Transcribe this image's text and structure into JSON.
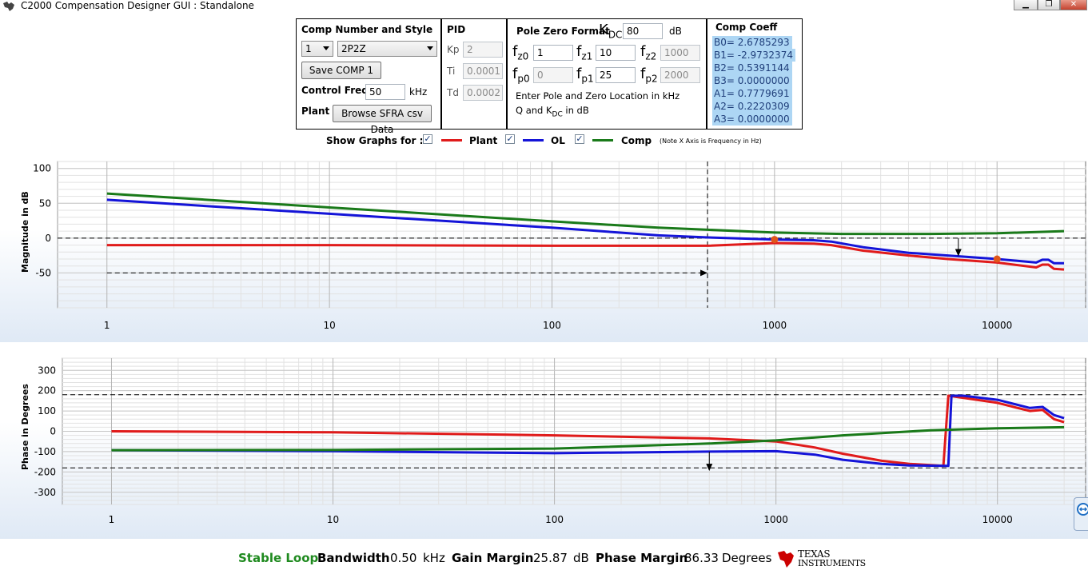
{
  "window": {
    "title": "C2000 Compensation Designer GUI : Standalone",
    "min_glyph": "▁",
    "max_glyph": "❐",
    "close_glyph": "✕"
  },
  "comp_panel": {
    "title": "Comp Number and Style",
    "comp_number": "1",
    "comp_style": "2P2Z",
    "save_label": "Save COMP 1",
    "control_freq_label": "Control Freq",
    "control_freq_value": "50",
    "control_freq_unit": "kHz",
    "plant_label": "Plant",
    "browse_label": "Browse SFRA csv Data"
  },
  "pid_panel": {
    "title": "PID",
    "kp_label": "Kp",
    "kp_value": "2",
    "ti_label": "Ti",
    "ti_value": "0.0001",
    "td_label": "Td",
    "td_value": "0.0002"
  },
  "pz_panel": {
    "title": "Pole Zero Format",
    "kdc_main": "K",
    "kdc_sub": "DC",
    "kdc_value": "80",
    "kdc_unit": "dB",
    "fz0_value": "1",
    "fz1_value": "10",
    "fz2_value": "1000",
    "fp0_value": "0",
    "fp1_value": "25",
    "fp2_value": "2000",
    "hint_line1": "Enter Pole and Zero Location in kHz",
    "hint_line2_a": "Q and K",
    "hint_line2_sub": "DC",
    "hint_line2_b": " in dB"
  },
  "coeff_panel": {
    "title": "Comp Coeff",
    "lines": [
      "B0= 2.6785293",
      "B1= -2.9732374",
      "B2= 0.5391144",
      "B3= 0.0000000",
      "A1= 0.7779691",
      "A2= 0.2220309",
      "A3= 0.0000000"
    ]
  },
  "show_graphs": {
    "label": "Show Graphs for :",
    "plant": "Plant",
    "ol": "OL",
    "comp": "Comp",
    "note": "(Note X Axis is Frequency in Hz)",
    "check_glyph": "✓"
  },
  "colors": {
    "plant": "#e01b1b",
    "ol": "#1414d8",
    "comp": "#1a7a1a",
    "stable": "#1f8a1f"
  },
  "mag_plot": {
    "ylabel": "Magnitude in dB",
    "yticks": [
      "100",
      "50",
      "0",
      "-50"
    ],
    "xticks": [
      "1",
      "10",
      "100",
      "1000",
      "10000"
    ]
  },
  "phase_plot": {
    "ylabel": "Phase in Degrees",
    "yticks": [
      "300",
      "200",
      "100",
      "0",
      "-100",
      "-200",
      "-300"
    ],
    "xticks": [
      "1",
      "10",
      "100",
      "1000",
      "10000"
    ]
  },
  "chart_data": [
    {
      "type": "line",
      "ylabel": "Magnitude in dB",
      "x_scale": "log",
      "xlim": [
        0.6,
        25000
      ],
      "ylim": [
        -100,
        110
      ],
      "grid": true,
      "series": [
        {
          "name": "Plant",
          "x": [
            1,
            10,
            100,
            300,
            500,
            1000,
            1500,
            1800,
            2500,
            4000,
            6000,
            10000,
            15000,
            16000,
            17000,
            18000,
            20000
          ],
          "y": [
            -10,
            -10,
            -11,
            -11,
            -11,
            -7,
            -8,
            -10,
            -18,
            -25,
            -30,
            -35,
            -42,
            -38,
            -38,
            -44,
            -45
          ]
        },
        {
          "name": "OL",
          "x": [
            1,
            10,
            100,
            300,
            500,
            1000,
            1500,
            1800,
            2500,
            4000,
            6000,
            10000,
            15000,
            16000,
            17000,
            18000,
            20000
          ],
          "y": [
            55,
            35,
            15,
            4,
            1,
            -2,
            -3,
            -5,
            -13,
            -21,
            -25,
            -30,
            -35,
            -31,
            -31,
            -36,
            -36
          ]
        },
        {
          "name": "Comp",
          "x": [
            1,
            10,
            100,
            300,
            500,
            1000,
            2000,
            5000,
            10000,
            20000
          ],
          "y": [
            64,
            44,
            24,
            15,
            12,
            8,
            6,
            6,
            7,
            10
          ]
        }
      ],
      "markers": [
        {
          "x": 1000,
          "y": -2
        },
        {
          "x": 10000,
          "y": -30
        }
      ],
      "hlines": [
        0
      ],
      "vlines": [
        500,
        25000
      ],
      "arrows": [
        {
          "type": "horizontal",
          "from": 1,
          "to": 500,
          "y": -50
        },
        {
          "type": "vertical",
          "x": 6700,
          "from": 0,
          "to": -26
        }
      ]
    },
    {
      "type": "line",
      "ylabel": "Phase in Degrees",
      "x_scale": "log",
      "xlim": [
        0.6,
        25000
      ],
      "ylim": [
        -360,
        360
      ],
      "grid": true,
      "series": [
        {
          "name": "Plant",
          "x": [
            1,
            10,
            100,
            500,
            1000,
            1500,
            2000,
            3000,
            4000,
            5700,
            6000,
            7000,
            10000,
            14000,
            16000,
            18000,
            20000
          ],
          "y": [
            0,
            -5,
            -20,
            -35,
            -50,
            -80,
            -110,
            -145,
            -160,
            -170,
            175,
            165,
            140,
            100,
            105,
            60,
            45
          ]
        },
        {
          "name": "OL",
          "x": [
            1,
            10,
            100,
            500,
            1000,
            1500,
            2000,
            3000,
            4000,
            6000,
            6200,
            7000,
            10000,
            14000,
            16000,
            18000,
            20000
          ],
          "y": [
            -93,
            -98,
            -108,
            -100,
            -98,
            -115,
            -140,
            -160,
            -168,
            -170,
            175,
            175,
            155,
            115,
            120,
            80,
            65
          ]
        },
        {
          "name": "Comp",
          "x": [
            1,
            10,
            100,
            500,
            1000,
            2000,
            5000,
            10000,
            20000
          ],
          "y": [
            -93,
            -92,
            -85,
            -60,
            -45,
            -20,
            5,
            15,
            20
          ]
        }
      ],
      "hlines": [
        180,
        -180
      ],
      "vlines": [
        25000
      ],
      "arrows": [
        {
          "type": "vertical",
          "x": 500,
          "from": -100,
          "to": -195
        }
      ]
    }
  ],
  "status": {
    "loop": "Stable Loop",
    "bw_label": "Bandwidth",
    "bw_value": "0.50",
    "bw_unit": "kHz",
    "gm_label": "Gain Margin",
    "gm_value": "25.87",
    "gm_unit": "dB",
    "pm_label": "Phase Margin",
    "pm_value": "86.33",
    "pm_unit": "Degrees",
    "logo_line1": "Texas",
    "logo_line2": "Instruments"
  }
}
